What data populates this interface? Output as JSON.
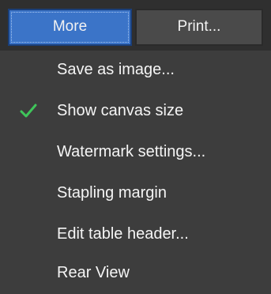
{
  "toolbar": {
    "more_label": "More",
    "print_label": "Print..."
  },
  "menu": {
    "items": [
      {
        "label": "Save as image...",
        "checked": false
      },
      {
        "label": "Show canvas size",
        "checked": true
      },
      {
        "label": "Watermark settings...",
        "checked": false
      },
      {
        "label": "Stapling margin",
        "checked": false
      },
      {
        "label": "Edit table header...",
        "checked": false
      },
      {
        "label": "Rear View",
        "checked": false
      }
    ]
  },
  "colors": {
    "accent": "#3b74c8",
    "check": "#3fc55a"
  },
  "icons": {
    "check": "checkmark-icon"
  }
}
